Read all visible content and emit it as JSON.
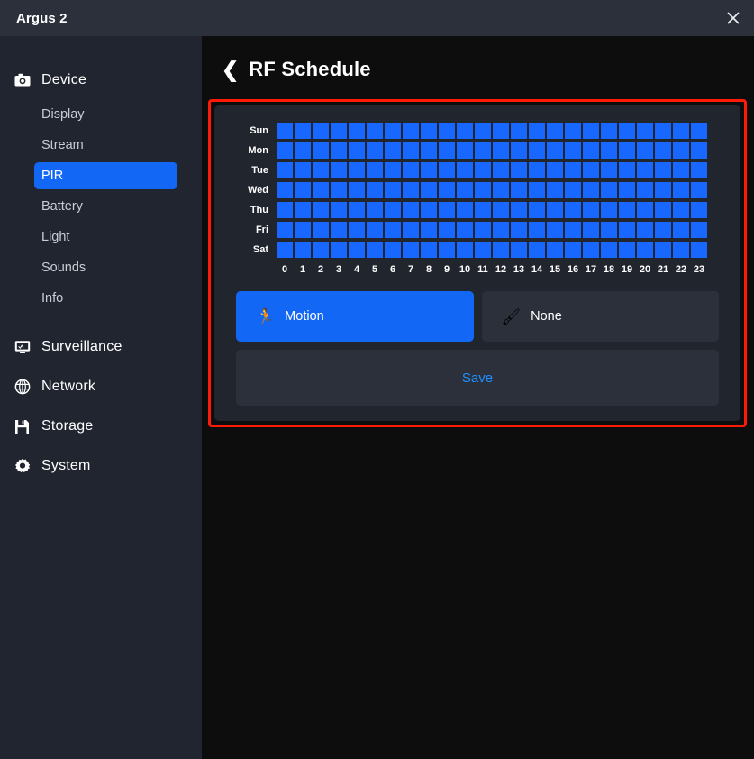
{
  "window": {
    "title": "Argus 2",
    "close_label": "close-icon"
  },
  "sidebar": {
    "groups": [
      {
        "label": "Device",
        "icon": "camera-icon",
        "items": [
          {
            "label": "Display",
            "active": false
          },
          {
            "label": "Stream",
            "active": false
          },
          {
            "label": "PIR",
            "active": true
          },
          {
            "label": "Battery",
            "active": false
          },
          {
            "label": "Light",
            "active": false
          },
          {
            "label": "Sounds",
            "active": false
          },
          {
            "label": "Info",
            "active": false
          }
        ]
      },
      {
        "label": "Surveillance",
        "icon": "monitor-icon",
        "items": []
      },
      {
        "label": "Network",
        "icon": "globe-icon",
        "items": []
      },
      {
        "label": "Storage",
        "icon": "floppy-disk-icon",
        "items": []
      },
      {
        "label": "System",
        "icon": "gear-icon",
        "items": []
      }
    ]
  },
  "header": {
    "back_icon": "❮",
    "title": "RF Schedule"
  },
  "schedule": {
    "days": [
      "Sun",
      "Mon",
      "Tue",
      "Wed",
      "Thu",
      "Fri",
      "Sat"
    ],
    "hours": [
      0,
      1,
      2,
      3,
      4,
      5,
      6,
      7,
      8,
      9,
      10,
      11,
      12,
      13,
      14,
      15,
      16,
      17,
      18,
      19,
      20,
      21,
      22,
      23
    ],
    "grid": [
      [
        1,
        1,
        1,
        1,
        1,
        1,
        1,
        1,
        1,
        1,
        1,
        1,
        1,
        1,
        1,
        1,
        1,
        1,
        1,
        1,
        1,
        1,
        1,
        1
      ],
      [
        1,
        1,
        1,
        1,
        1,
        1,
        1,
        1,
        1,
        1,
        1,
        1,
        1,
        1,
        1,
        1,
        1,
        1,
        1,
        1,
        1,
        1,
        1,
        1
      ],
      [
        1,
        1,
        1,
        1,
        1,
        1,
        1,
        1,
        1,
        1,
        1,
        1,
        1,
        1,
        1,
        1,
        1,
        1,
        1,
        1,
        1,
        1,
        1,
        1
      ],
      [
        1,
        1,
        1,
        1,
        1,
        1,
        1,
        1,
        1,
        1,
        1,
        1,
        1,
        1,
        1,
        1,
        1,
        1,
        1,
        1,
        1,
        1,
        1,
        1
      ],
      [
        1,
        1,
        1,
        1,
        1,
        1,
        1,
        1,
        1,
        1,
        1,
        1,
        1,
        1,
        1,
        1,
        1,
        1,
        1,
        1,
        1,
        1,
        1,
        1
      ],
      [
        1,
        1,
        1,
        1,
        1,
        1,
        1,
        1,
        1,
        1,
        1,
        1,
        1,
        1,
        1,
        1,
        1,
        1,
        1,
        1,
        1,
        1,
        1,
        1
      ],
      [
        1,
        1,
        1,
        1,
        1,
        1,
        1,
        1,
        1,
        1,
        1,
        1,
        1,
        1,
        1,
        1,
        1,
        1,
        1,
        1,
        1,
        1,
        1,
        1
      ]
    ]
  },
  "modes": [
    {
      "label": "Motion",
      "icon": "🏃",
      "icon_name": "running-person-icon",
      "active": true
    },
    {
      "label": "None",
      "icon": "🖌",
      "icon_name": "brush-icon",
      "active": false
    }
  ],
  "save": {
    "label": "Save"
  },
  "colors": {
    "accent": "#1268f5",
    "cell_on": "#1868ff",
    "cell_off": "#2b303b",
    "panel": "#21252e",
    "sidebar": "#212530",
    "titlebar": "#2b303b",
    "content": "#0d0d0d",
    "highlight_border": "#ff1a07",
    "save_text": "#1e90ff"
  }
}
